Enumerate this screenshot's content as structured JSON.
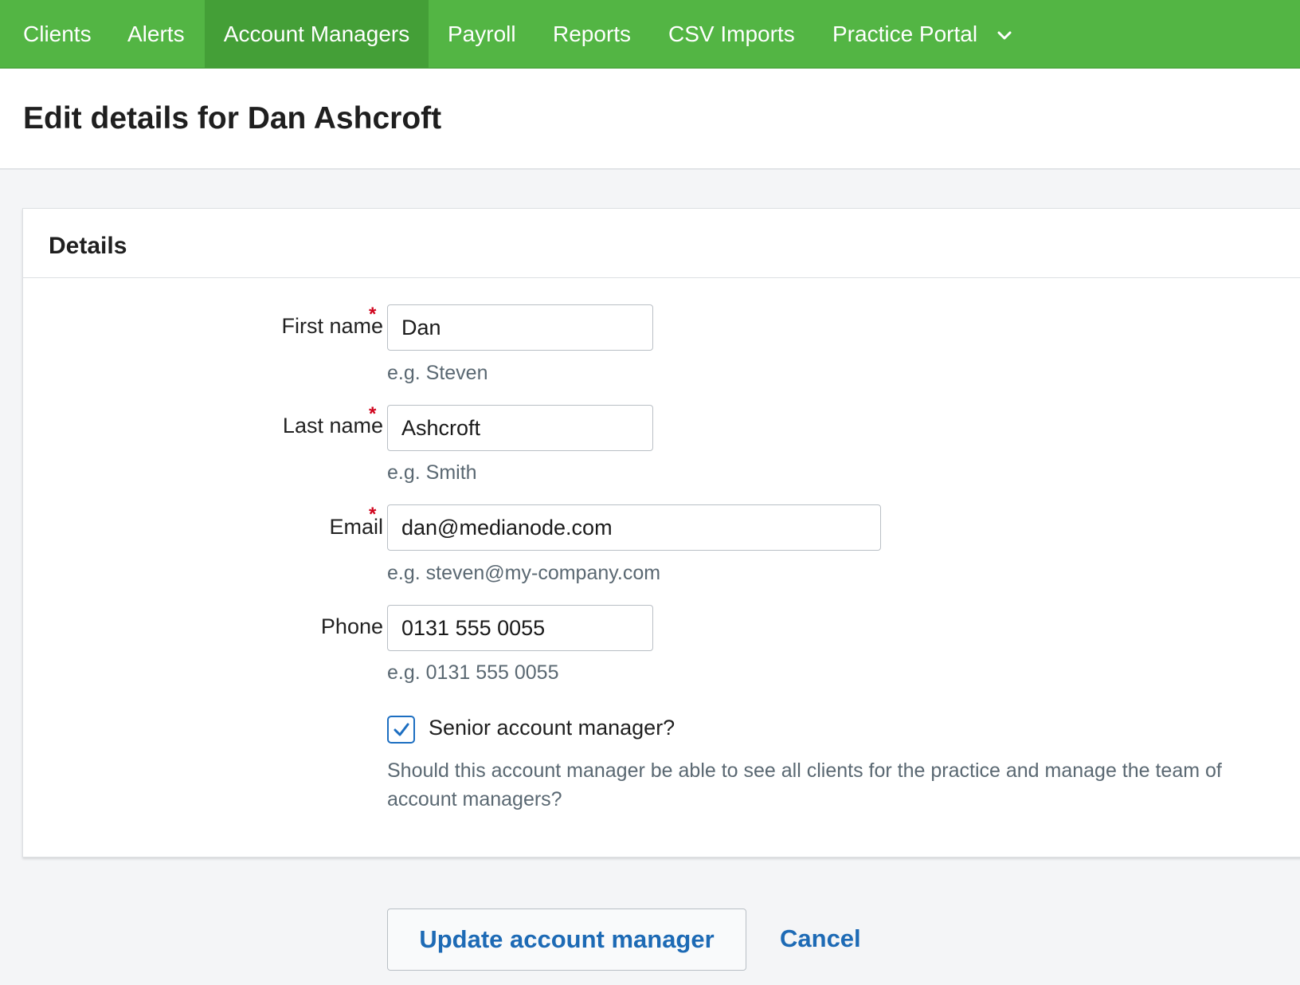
{
  "nav": {
    "items": [
      {
        "label": "Clients"
      },
      {
        "label": "Alerts"
      },
      {
        "label": "Account Managers",
        "active": true
      },
      {
        "label": "Payroll"
      },
      {
        "label": "Reports"
      },
      {
        "label": "CSV Imports"
      },
      {
        "label": "Practice Portal",
        "icon": "chevron-down-icon"
      }
    ]
  },
  "page": {
    "title": "Edit details for Dan Ashcroft"
  },
  "details": {
    "title": "Details",
    "required_marker": "*",
    "first_name": {
      "label": "First name",
      "value": "Dan",
      "hint": "e.g. Steven",
      "required": true
    },
    "last_name": {
      "label": "Last name",
      "value": "Ashcroft",
      "hint": "e.g. Smith",
      "required": true
    },
    "email": {
      "label": "Email",
      "value": "dan@medianode.com",
      "hint": "e.g. steven@my-company.com",
      "required": true
    },
    "phone": {
      "label": "Phone",
      "value": "0131 555 0055",
      "hint": "e.g. 0131 555 0055",
      "required": false
    },
    "senior": {
      "label": "Senior account manager?",
      "checked": true,
      "help": "Should this account manager be able to see all clients for the practice and manage the team of account managers?"
    }
  },
  "actions": {
    "update_label": "Update account manager",
    "cancel_label": "Cancel"
  },
  "colors": {
    "nav_bg": "#53b544",
    "nav_active_bg": "#449f37",
    "link": "#1d6ab5",
    "required": "#d0021b",
    "checkbox": "#1c6ec1"
  }
}
